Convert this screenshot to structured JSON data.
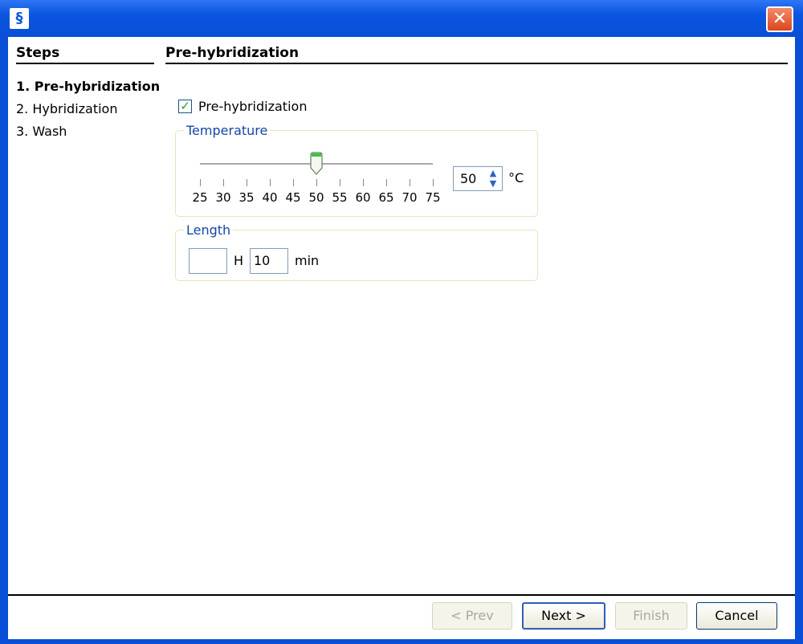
{
  "window": {
    "close_glyph": "✕",
    "app_icon": "app-icon"
  },
  "steps": {
    "title": "Steps",
    "items": [
      {
        "label": "1. Pre-hybridization",
        "active": true
      },
      {
        "label": "2. Hybridization",
        "active": false
      },
      {
        "label": "3. Wash",
        "active": false
      }
    ]
  },
  "section": {
    "title": "Pre-hybridization",
    "checkbox_label": "Pre-hybridization",
    "checkbox_checked": true
  },
  "temperature": {
    "legend": "Temperature",
    "ticks": [
      "25",
      "30",
      "35",
      "40",
      "45",
      "50",
      "55",
      "60",
      "65",
      "70",
      "75"
    ],
    "slider_value": 50,
    "slider_min": 25,
    "slider_max": 75,
    "spin_value": "50",
    "unit": "°C"
  },
  "length": {
    "legend": "Length",
    "hours_value": "",
    "hours_label": "H",
    "minutes_value": "10",
    "minutes_label": "min"
  },
  "buttons": {
    "prev": "< Prev",
    "next": "Next >",
    "finish": "Finish",
    "cancel": "Cancel"
  },
  "colors": {
    "titlebar": "#0a55e0",
    "legend": "#1446a8",
    "check": "#21a121"
  }
}
